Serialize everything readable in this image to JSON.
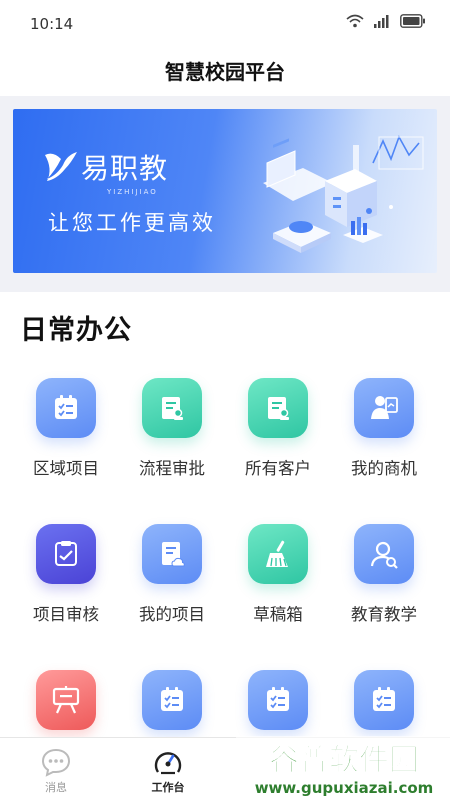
{
  "status": {
    "time": "10:14"
  },
  "header": {
    "title": "智慧校园平台"
  },
  "banner": {
    "brand": "易职教",
    "brand_sub": "YIZHIJIAO",
    "slogan": "让您工作更高效"
  },
  "section": {
    "title": "日常办公"
  },
  "apps": [
    {
      "label": "区域项目",
      "icon": "checklist-calendar-icon",
      "color": "blue"
    },
    {
      "label": "流程审批",
      "icon": "approval-stamp-icon",
      "color": "green"
    },
    {
      "label": "所有客户",
      "icon": "customer-stamp-icon",
      "color": "green"
    },
    {
      "label": "我的商机",
      "icon": "person-presentation-icon",
      "color": "blue"
    },
    {
      "label": "项目审核",
      "icon": "audit-check-icon",
      "color": "purple"
    },
    {
      "label": "我的项目",
      "icon": "document-cloud-icon",
      "color": "blue"
    },
    {
      "label": "草稿箱",
      "icon": "broom-icon",
      "color": "green"
    },
    {
      "label": "教育教学",
      "icon": "teacher-search-icon",
      "color": "blue"
    },
    {
      "label": "",
      "icon": "easel-board-icon",
      "color": "red"
    },
    {
      "label": "",
      "icon": "checklist-calendar-icon",
      "color": "blue"
    },
    {
      "label": "",
      "icon": "checklist-calendar-icon",
      "color": "blue"
    },
    {
      "label": "",
      "icon": "checklist-calendar-icon",
      "color": "blue"
    }
  ],
  "tabs": [
    {
      "label": "消息",
      "icon": "chat-bubble-icon",
      "active": false
    },
    {
      "label": "工作台",
      "icon": "speedometer-icon",
      "active": true
    }
  ],
  "watermark": {
    "text": "谷普软件园",
    "url": "www.gupuxiazai.com"
  },
  "colors": {
    "primary": "#4f86f6",
    "green": "#2fc6a3",
    "purple": "#4b43d6",
    "red": "#ee5a5a"
  }
}
